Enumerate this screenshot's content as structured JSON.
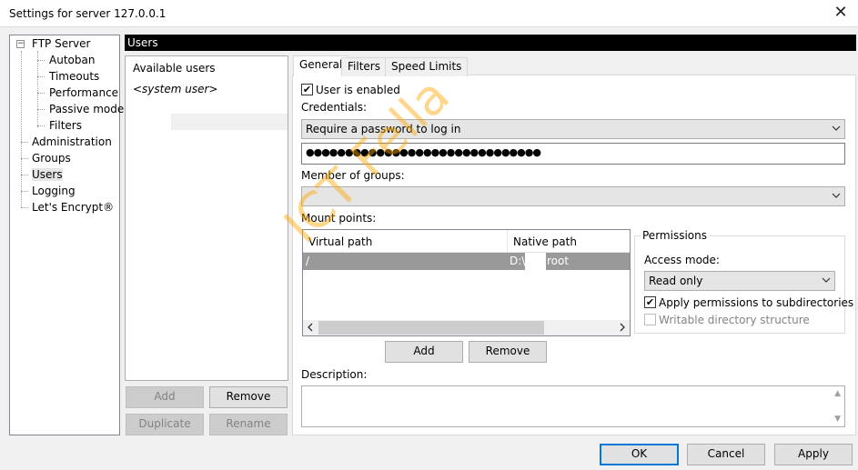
{
  "window": {
    "title": "Settings for server 127.0.0.1",
    "close_glyph": "✕"
  },
  "tree": {
    "root": "FTP Server",
    "children": [
      "Autoban",
      "Timeouts",
      "Performance",
      "Passive mode",
      "Filters"
    ],
    "items": [
      "Administration",
      "Groups",
      "Users",
      "Logging",
      "Let's Encrypt®"
    ],
    "selected": "Users"
  },
  "panel": {
    "header": "Users"
  },
  "users": {
    "header": "Available users",
    "list": [
      "<system user>"
    ],
    "buttons": {
      "add": "Add",
      "remove": "Remove",
      "duplicate": "Duplicate",
      "rename": "Rename"
    }
  },
  "tabs": {
    "general": "General",
    "filters": "Filters",
    "speed_limits": "Speed Limits"
  },
  "general": {
    "user_enabled_label": "User is enabled",
    "user_enabled_checked": true,
    "credentials_label": "Credentials:",
    "credentials_value": "Require a password to log in",
    "password_mask": "●●●●●●●●●●●●●●●●●●●●●●●●●●●●●●",
    "member_of_groups_label": "Member of groups:",
    "member_of_groups_value": "",
    "mount_points_label": "Mount points:",
    "mount_table": {
      "columns": [
        "Virtual path",
        "Native path"
      ],
      "rows": [
        {
          "virtual": "/",
          "native_prefix": "D:\\",
          "native_suffix": "root"
        }
      ]
    },
    "mount_add": "Add",
    "mount_remove": "Remove",
    "permissions": {
      "legend": "Permissions",
      "access_mode_label": "Access mode:",
      "access_mode_value": "Read only",
      "apply_subdirs_label": "Apply permissions to subdirectories",
      "apply_subdirs_checked": true,
      "writable_dir_label": "Writable directory structure",
      "writable_dir_checked": false
    },
    "description_label": "Description:",
    "description_value": ""
  },
  "footer": {
    "ok": "OK",
    "cancel": "Cancel",
    "apply": "Apply"
  },
  "watermark": "ICT Fella",
  "colors": {
    "accent": "#0078d7",
    "selection_gray": "#999999",
    "watermark": "#ffa600"
  }
}
